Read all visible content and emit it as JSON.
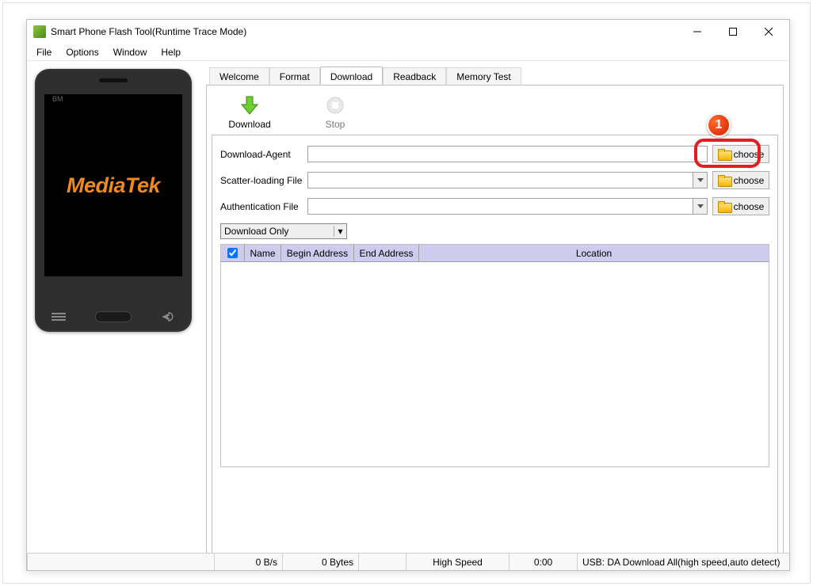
{
  "window": {
    "title": "Smart Phone Flash Tool(Runtime Trace Mode)"
  },
  "menu": {
    "file": "File",
    "options": "Options",
    "window": "Window",
    "help": "Help"
  },
  "phone": {
    "bm": "BM",
    "brand": "MediaTek"
  },
  "tabs": {
    "welcome": "Welcome",
    "format": "Format",
    "download": "Download",
    "readback": "Readback",
    "memory": "Memory Test"
  },
  "toolbar": {
    "download": "Download",
    "stop": "Stop"
  },
  "form": {
    "da_label": "Download-Agent",
    "scatter_label": "Scatter-loading File",
    "auth_label": "Authentication File",
    "choose": "choose",
    "mode": "Download Only"
  },
  "table": {
    "name": "Name",
    "begin": "Begin Address",
    "end": "End Address",
    "location": "Location"
  },
  "status": {
    "speed": "0 B/s",
    "bytes": "0 Bytes",
    "mode": "High Speed",
    "time": "0:00",
    "usb": "USB: DA Download All(high speed,auto detect)"
  },
  "annotation": {
    "badge1": "1"
  }
}
